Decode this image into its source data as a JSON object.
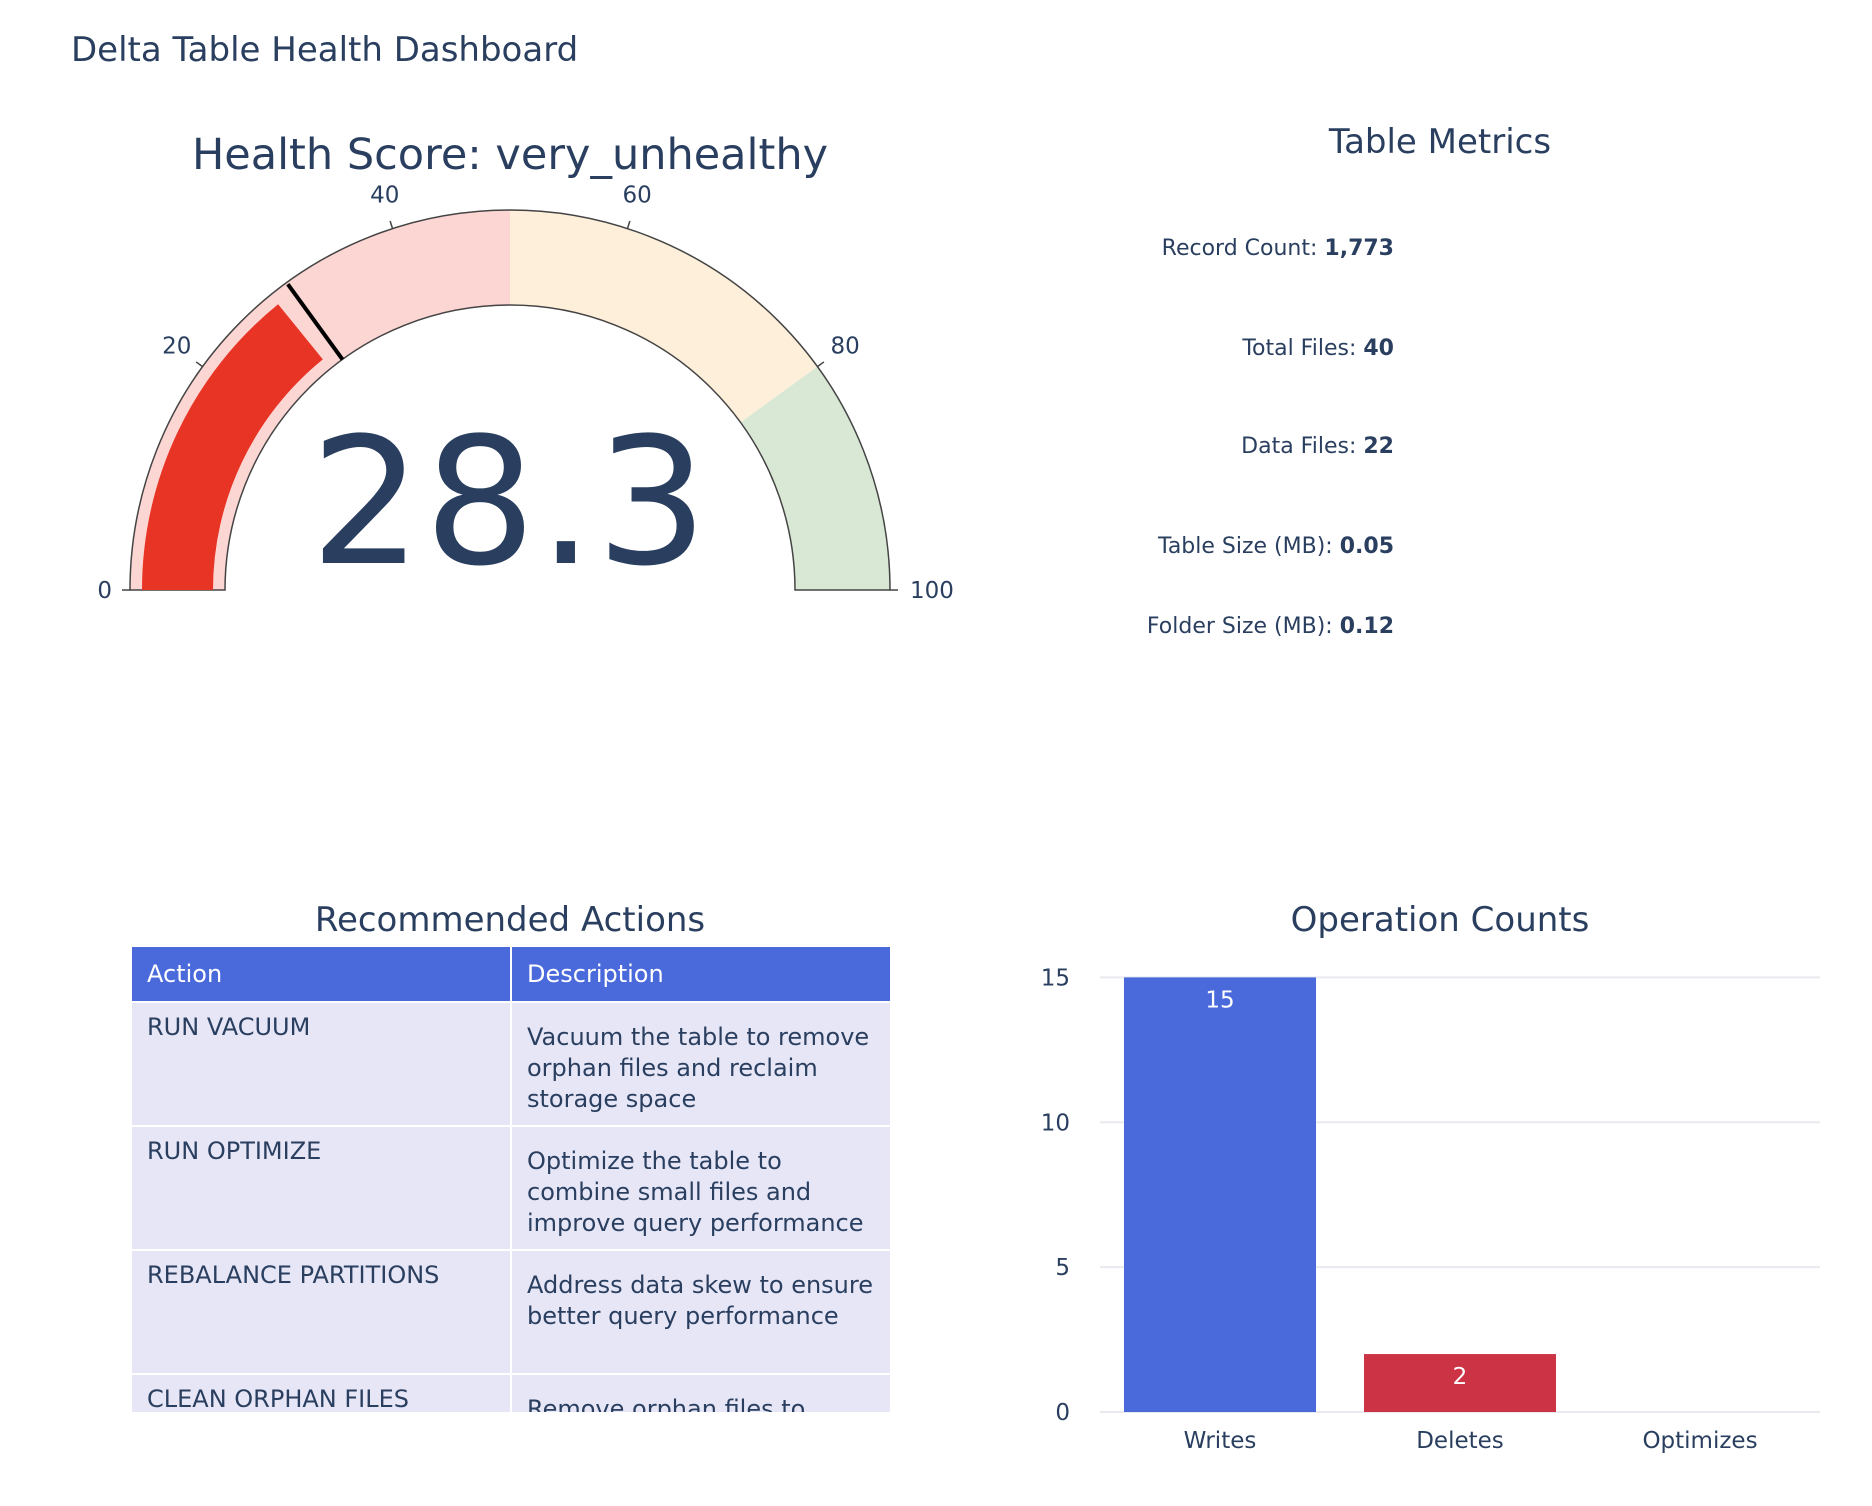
{
  "page_title": "Delta Table Health Dashboard",
  "gauge": {
    "title": "Health Score: very_unhealthy",
    "value": 28.3,
    "value_text": "28.3",
    "range": [
      0,
      100
    ],
    "ticks": [
      "0",
      "20",
      "40",
      "60",
      "80",
      "100"
    ],
    "steps": [
      {
        "range": [
          0,
          50
        ],
        "color": "#fcd6d3"
      },
      {
        "range": [
          50,
          80
        ],
        "color": "#fdefd9"
      },
      {
        "range": [
          80,
          100
        ],
        "color": "#d8e8d4"
      }
    ],
    "bar_color": "#e83425",
    "threshold": 30
  },
  "metrics": {
    "title": "Table Metrics",
    "items": [
      {
        "label": "Record Count:",
        "value": "1,773"
      },
      {
        "label": "Total Files:",
        "value": "40"
      },
      {
        "label": "Data Files:",
        "value": "22"
      },
      {
        "label": "Table Size (MB):",
        "value": "0.05"
      },
      {
        "label": "Folder Size (MB):",
        "value": "0.12"
      }
    ]
  },
  "actions": {
    "title": "Recommended Actions",
    "headers": [
      "Action",
      "Description"
    ],
    "rows": [
      {
        "action": "RUN VACUUM",
        "description": "Vacuum the table to remove orphan files and reclaim storage space"
      },
      {
        "action": "RUN OPTIMIZE",
        "description": "Optimize the table to combine small files and improve query performance"
      },
      {
        "action": "REBALANCE PARTITIONS",
        "description": "Address data skew to ensure better query performance"
      },
      {
        "action": "CLEAN ORPHAN FILES",
        "description": "Remove orphan files to"
      }
    ]
  },
  "chart_data": {
    "type": "bar",
    "title": "Operation Counts",
    "categories": [
      "Writes",
      "Deletes",
      "Optimizes"
    ],
    "values": [
      15,
      2,
      0
    ],
    "colors": [
      "#4a6adb",
      "#cc3344",
      "#4aa84a"
    ],
    "ylim": [
      0,
      15.6
    ],
    "yticks": [
      0,
      5,
      10,
      15
    ],
    "xlabel": "",
    "ylabel": "",
    "grid": true
  }
}
